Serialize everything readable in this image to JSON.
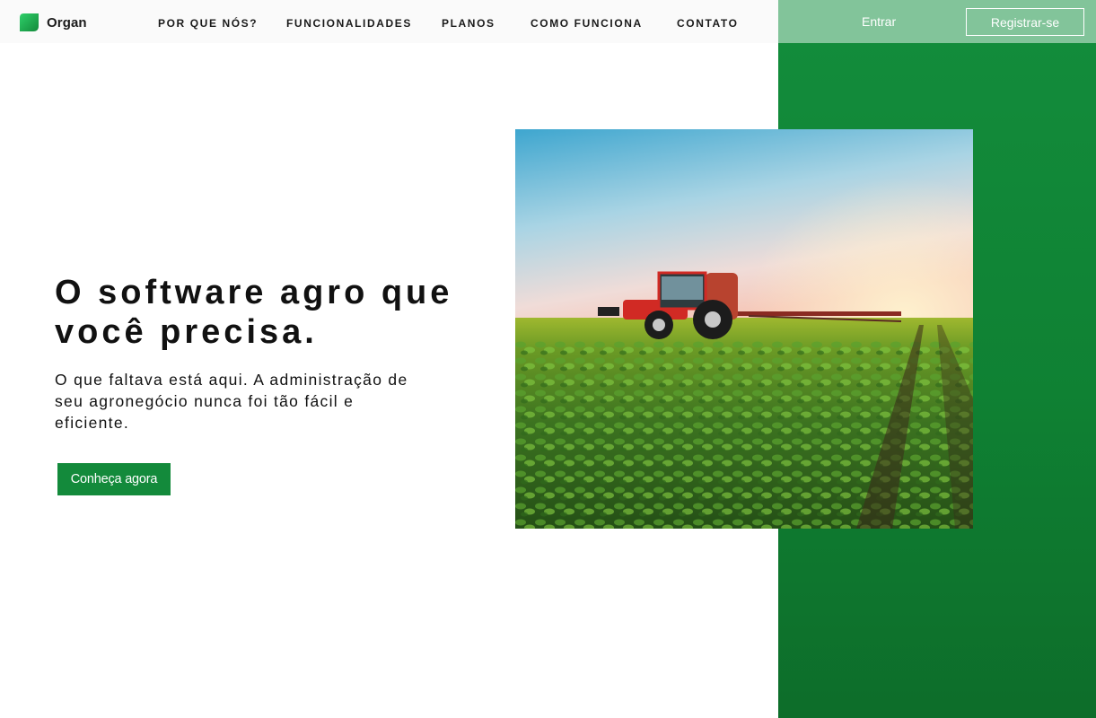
{
  "brand": {
    "name": "Organ",
    "logo_icon": "leaf-logo-icon",
    "logo_color": "#1db954"
  },
  "nav": {
    "items": [
      {
        "label": "POR QUE NÓS?"
      },
      {
        "label": "FUNCIONALIDADES"
      },
      {
        "label": "PLANOS"
      },
      {
        "label": "COMO FUNCIONA"
      },
      {
        "label": "CONTATO"
      }
    ]
  },
  "auth": {
    "login_label": "Entrar",
    "register_label": "Registrar-se"
  },
  "hero": {
    "title_line1": "O software agro que",
    "title_line2": "você precisa.",
    "subtitle_line1": "O que faltava está aqui. A administração de",
    "subtitle_line2": "seu agronegócio nunca foi tão fácil e",
    "subtitle_line3": "eficiente.",
    "cta_label": "Conheça agora",
    "image_subject": "tractor-spraying-crop-field"
  },
  "colors": {
    "accent_green": "#138a3b",
    "panel_green": "#0f8133",
    "auth_bar": "#82c49a",
    "nav_bg": "#fafafa"
  }
}
